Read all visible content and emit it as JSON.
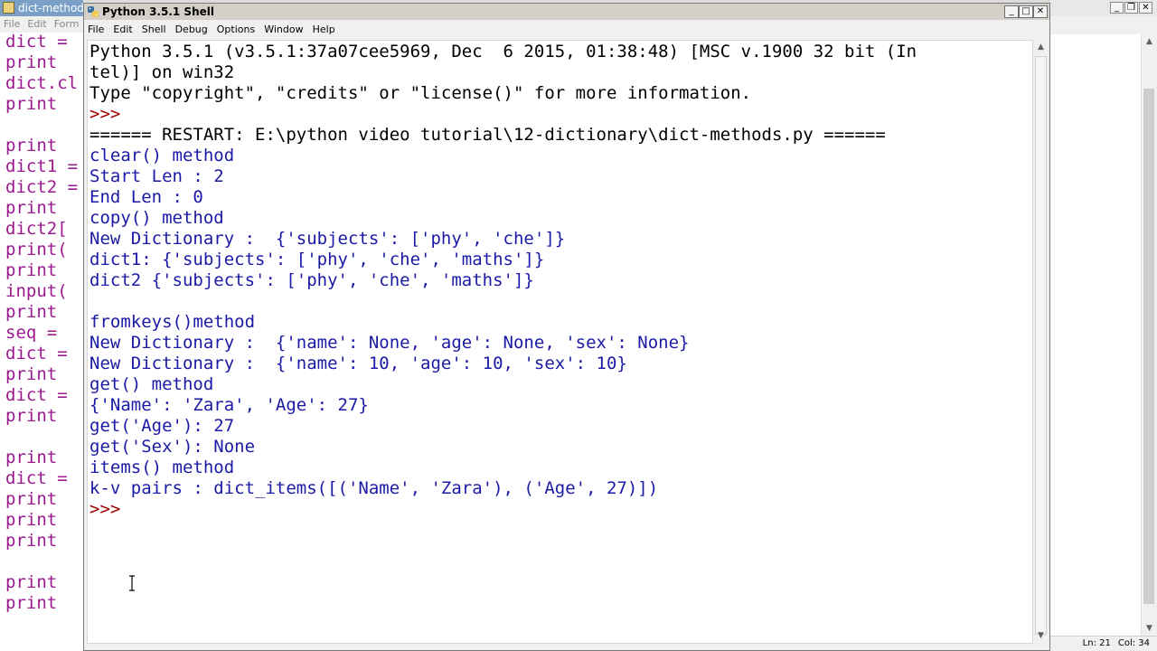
{
  "bg_editor": {
    "title": "dict-methods",
    "menu": [
      "File",
      "Edit",
      "Form"
    ],
    "code_lines": [
      "dict =",
      "print",
      "dict.cl",
      "print",
      "",
      "print",
      "dict1 =",
      "dict2 =",
      "print",
      "dict2[",
      "print(",
      "print",
      "input(",
      "print",
      "seq =",
      "dict =",
      "print",
      "dict =",
      "print",
      "",
      "print",
      "dict =",
      "print",
      "print",
      "print",
      "",
      "print",
      "print"
    ]
  },
  "bg_right": {
    "status": {
      "ln": "Ln: 21",
      "col": "Col: 34"
    }
  },
  "shell": {
    "title": "Python 3.5.1 Shell",
    "menu": [
      "File",
      "Edit",
      "Shell",
      "Debug",
      "Options",
      "Window",
      "Help"
    ],
    "lines": [
      {
        "text": "Python 3.5.1 (v3.5.1:37a07cee5969, Dec  6 2015, 01:38:48) [MSC v.1900 32 bit (In",
        "style": "sys"
      },
      {
        "text": "tel)] on win32",
        "style": "sys"
      },
      {
        "text": "Type \"copyright\", \"credits\" or \"license()\" for more information.",
        "style": "sys"
      },
      {
        "text": ">>> ",
        "style": "prompt"
      },
      {
        "text": "====== RESTART: E:\\python video tutorial\\12-dictionary\\dict-methods.py ======",
        "style": "sys"
      },
      {
        "text": "clear() method",
        "style": "out"
      },
      {
        "text": "Start Len : 2",
        "style": "out"
      },
      {
        "text": "End Len : 0",
        "style": "out"
      },
      {
        "text": "copy() method",
        "style": "out"
      },
      {
        "text": "New Dictionary :  {'subjects': ['phy', 'che']}",
        "style": "out"
      },
      {
        "text": "dict1: {'subjects': ['phy', 'che', 'maths']}",
        "style": "out"
      },
      {
        "text": "dict2 {'subjects': ['phy', 'che', 'maths']}",
        "style": "out"
      },
      {
        "text": "",
        "style": "out"
      },
      {
        "text": "fromkeys()method",
        "style": "out"
      },
      {
        "text": "New Dictionary :  {'name': None, 'age': None, 'sex': None}",
        "style": "out"
      },
      {
        "text": "New Dictionary :  {'name': 10, 'age': 10, 'sex': 10}",
        "style": "out"
      },
      {
        "text": "get() method",
        "style": "out"
      },
      {
        "text": "{'Name': 'Zara', 'Age': 27}",
        "style": "out"
      },
      {
        "text": "get('Age'): 27",
        "style": "out"
      },
      {
        "text": "get('Sex'): None",
        "style": "out"
      },
      {
        "text": "items() method",
        "style": "out"
      },
      {
        "text": "k-v pairs : dict_items([('Name', 'Zara'), ('Age', 27)])",
        "style": "out"
      },
      {
        "text": ">>> ",
        "style": "prompt"
      }
    ]
  },
  "colors": {
    "output_text": "#1a1aa6",
    "system_text": "#000000",
    "prompt_text": "#a00000",
    "editor_keyword": "#9b1a8f"
  }
}
